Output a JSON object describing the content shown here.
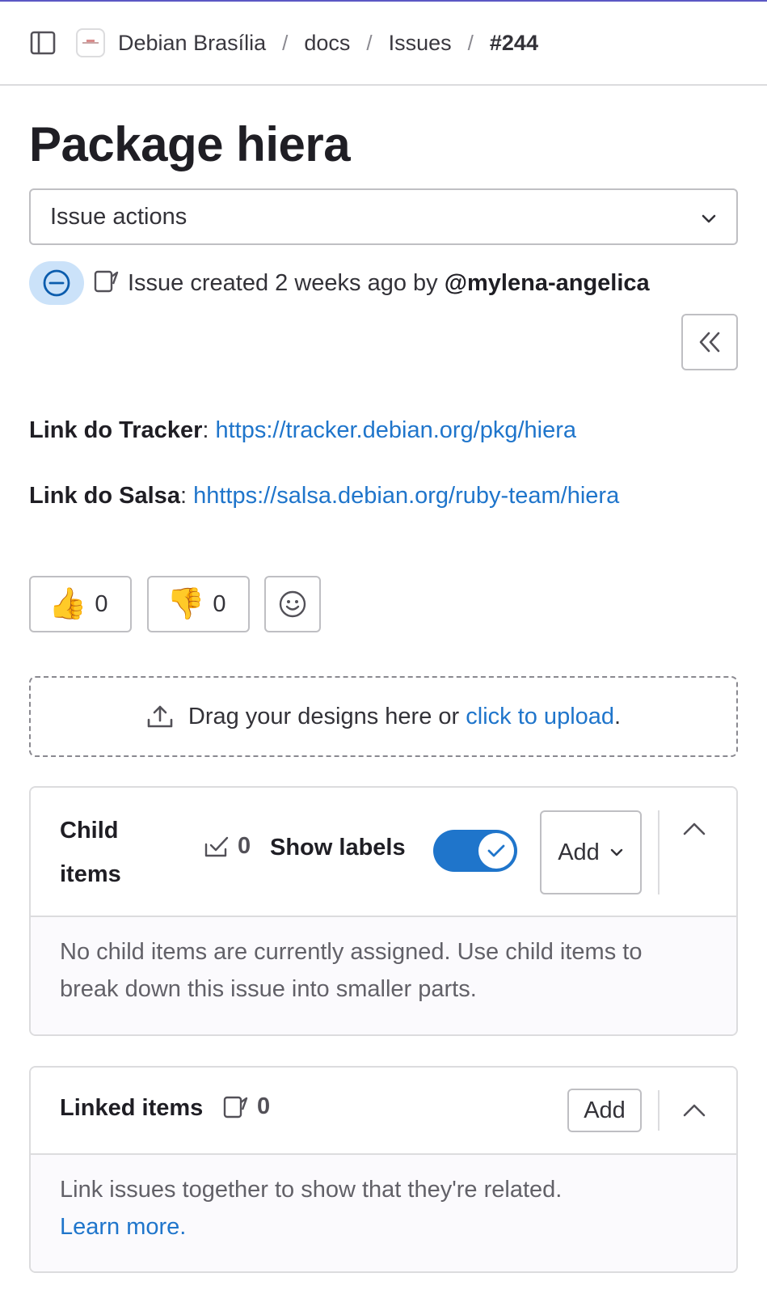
{
  "breadcrumb": {
    "items": [
      "Debian Brasília",
      "docs",
      "Issues",
      "#244"
    ],
    "separator": "/"
  },
  "issue": {
    "title": "Package hiera",
    "actions_label": "Issue actions",
    "status_icon": "issue-open-icon",
    "meta_text": "Issue created 2 weeks ago by",
    "author": "@mylena-angelica"
  },
  "description": {
    "tracker_label": "Link do Tracker",
    "tracker_url": "https://tracker.debian.org/pkg/hiera",
    "salsa_label": "Link do Salsa",
    "salsa_url": "hhttps://salsa.debian.org/ruby-team/hiera"
  },
  "reactions": [
    {
      "emoji": "👍",
      "icon": "thumbs-up-icon",
      "count": "0"
    },
    {
      "emoji": "👎",
      "icon": "thumbs-down-icon",
      "count": "0"
    }
  ],
  "dropzone": {
    "text": "Drag your designs here or",
    "link": "click to upload",
    "suffix": "."
  },
  "child_items": {
    "title": "Child items",
    "count": "0",
    "show_labels": "Show labels",
    "show_labels_on": true,
    "add_label": "Add",
    "empty_text": "No child items are currently assigned. Use child items to break down this issue into smaller parts."
  },
  "linked_items": {
    "title": "Linked items",
    "count": "0",
    "add_label": "Add",
    "empty_text": "Link issues together to show that they're related.",
    "learn_more": "Learn more."
  },
  "colors": {
    "accent": "#1f75cb",
    "status_badge_bg": "#cbe2f9",
    "top_line": "#5b57c4"
  }
}
